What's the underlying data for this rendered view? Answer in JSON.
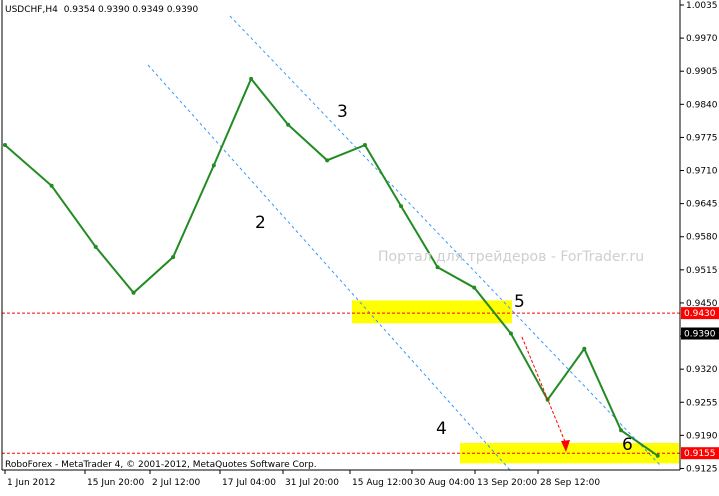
{
  "header": {
    "symbol_label": "USDCHF,H4",
    "ohlc_values": "0.9354 0.9390 0.9349 0.9390"
  },
  "footer": {
    "copyright": "RoboForex - MetaTrader 4, © 2001-2012, MetaQuotes Software Corp."
  },
  "watermark": "Портал для трейдеров - ForTrader.ru",
  "chart_data": {
    "type": "line",
    "title": "USDCHF,H4",
    "ylim": [
      0.9122,
      1.0035
    ],
    "y_ticks": [
      "1.0035",
      "0.9970",
      "0.9905",
      "0.9840",
      "0.9775",
      "0.9710",
      "0.9645",
      "0.9580",
      "0.9515",
      "0.9450",
      "0.9385",
      "0.9320",
      "0.9255",
      "0.9190",
      "0.9125"
    ],
    "x_ticks": [
      "1 Jun 2012",
      "15 Jun 20:00",
      "2 Jul 12:00",
      "17 Jul 04:00",
      "31 Jul 20:00",
      "15 Aug 12:00",
      "30 Aug 04:00",
      "13 Sep 20:00",
      "28 Sep 12:00"
    ],
    "series": [
      {
        "name": "",
        "color": "#228b22",
        "x": [
          "1 Jun 2012",
          "8 Jun 2012",
          "15 Jun 20:00",
          "22 Jun 2012",
          "2 Jul 12:00",
          "10 Jul 2012",
          "17 Jul 04:00",
          "24 Jul 2012",
          "31 Jul 20:00",
          "8 Aug 2012",
          "15 Aug 12:00",
          "22 Aug 2012",
          "30 Aug 04:00",
          "6 Sep 2012",
          "13 Sep 20:00",
          "20 Sep 2012",
          "28 Sep 12:00",
          "5 Oct 2012"
        ],
        "values": [
          0.976,
          0.968,
          0.956,
          0.947,
          0.954,
          0.972,
          0.989,
          0.98,
          0.973,
          0.976,
          0.964,
          0.952,
          0.948,
          0.939,
          0.926,
          0.936,
          0.92,
          0.915
        ]
      }
    ],
    "price_markers": [
      {
        "label": "0.9430",
        "value": 0.943,
        "color": "#ff0000"
      },
      {
        "label": "0.9390",
        "value": 0.939,
        "color": "#000000"
      },
      {
        "label": "0.9155",
        "value": 0.9155,
        "color": "#ff0000"
      }
    ],
    "wave_labels": [
      "2",
      "3",
      "4",
      "5",
      "6"
    ],
    "support_zones": [
      {
        "from": 0.941,
        "to": 0.9455,
        "color": "#ffff00"
      },
      {
        "from": 0.9135,
        "to": 0.9175,
        "color": "#ffff00"
      }
    ],
    "grid": false
  }
}
